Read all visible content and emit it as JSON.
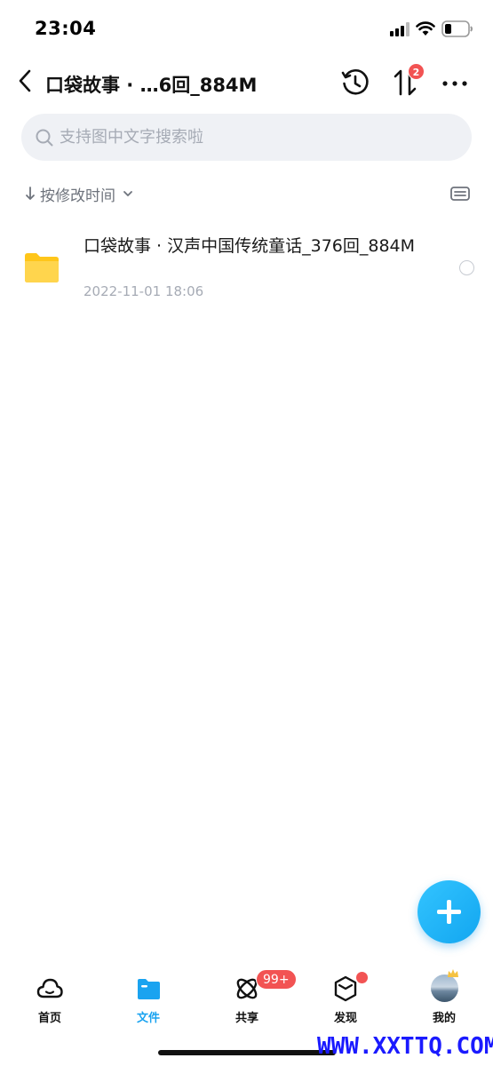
{
  "status_bar": {
    "time": "23:04"
  },
  "header": {
    "back_icon": "chevron-left-icon",
    "title": "口袋故事 · …6回_884M",
    "history_icon": "history-clock-icon",
    "transfer_icon": "transfer-arrows-icon",
    "transfer_badge": "2",
    "more_icon": "more-dots-icon"
  },
  "search": {
    "placeholder": "支持图中文字搜索啦"
  },
  "sort": {
    "label": "按修改时间",
    "view_toggle_icon": "view-toggle-icon"
  },
  "files": [
    {
      "icon": "folder-icon",
      "name": "口袋故事 · 汉声中国传统童话_376回_884M",
      "date": "2022-11-01 18:06"
    }
  ],
  "fab": {
    "icon": "plus-icon"
  },
  "tabs": [
    {
      "label": "首页",
      "icon": "cloud-icon"
    },
    {
      "label": "文件",
      "icon": "folder-tab-icon",
      "active": true
    },
    {
      "label": "共享",
      "icon": "share-orbit-icon",
      "badge": "99+"
    },
    {
      "label": "发现",
      "icon": "cube-icon"
    },
    {
      "label": "我的",
      "icon": "avatar"
    }
  ],
  "colors": {
    "accent": "#1aa3f0",
    "badge": "#f25353",
    "folder": "#ffc61a"
  },
  "watermark": "WWW.XXTTQ.COM"
}
